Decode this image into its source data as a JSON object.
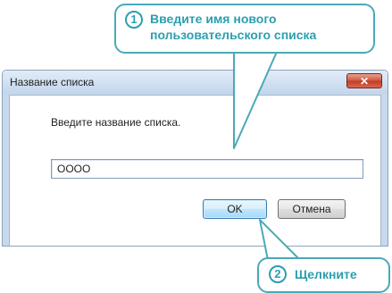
{
  "dialog": {
    "title": "Название списка",
    "close_symbol": "✕",
    "prompt": "Введите название списка.",
    "input_value": "OOOO",
    "ok_label": "OK",
    "cancel_label": "Отмена"
  },
  "callouts": [
    {
      "number": "1",
      "line1": "Введите имя нового",
      "line2": "пользовательского списка"
    },
    {
      "number": "2",
      "line1": "Щелкните"
    }
  ],
  "colors": {
    "callout_accent": "#2c9fb0",
    "callout_border": "#49aab7",
    "close_button": "#c13b24",
    "window_frame": "#c7d9ec"
  }
}
